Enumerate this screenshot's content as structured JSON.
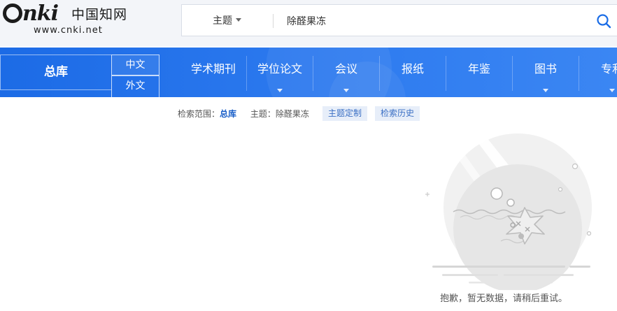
{
  "header": {
    "logo": {
      "brand": "nki",
      "chinese": "中国知网",
      "url": "www.cnki.net"
    },
    "search": {
      "scope_label": "主题",
      "query": "除醛果冻",
      "search_icon": "search-icon"
    }
  },
  "nav": {
    "main_label": "总库",
    "lang_cn": "中文",
    "lang_foreign": "外文",
    "items": [
      {
        "label": "学术期刊",
        "has_dropdown": false
      },
      {
        "label": "学位论文",
        "has_dropdown": true
      },
      {
        "label": "会议",
        "has_dropdown": true
      },
      {
        "label": "报纸",
        "has_dropdown": false
      },
      {
        "label": "年鉴",
        "has_dropdown": false
      },
      {
        "label": "图书",
        "has_dropdown": true
      },
      {
        "label": "专利",
        "has_dropdown": true
      }
    ]
  },
  "search_info": {
    "range_key": "检索范围：",
    "range_value": "总库",
    "topic_key": "主题：",
    "topic_value": "除醛果冻",
    "customize_button": "主题定制",
    "history_button": "检索历史"
  },
  "empty_state": {
    "illustration": "starfish-in-bowl-illustration",
    "message": "抱歉，暂无数据，请稍后重试。"
  },
  "colors": {
    "nav_blue": "#1c6be6",
    "link_blue": "#1a5fc8",
    "chip_bg": "#e7eef9"
  }
}
